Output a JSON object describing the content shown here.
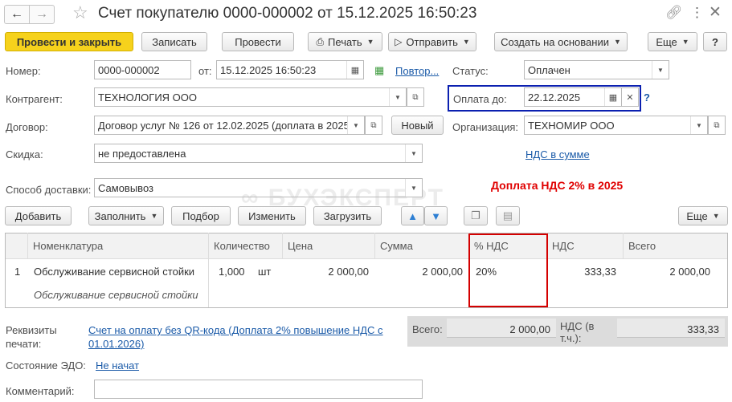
{
  "window": {
    "title": "Счет покупателю 0000-000002 от 15.12.2025 16:50:23"
  },
  "toolbar": {
    "post_close": "Провести и закрыть",
    "save": "Записать",
    "post": "Провести",
    "print": "Печать",
    "send": "Отправить",
    "create_based": "Создать на основании",
    "more": "Еще",
    "help": "?"
  },
  "form": {
    "number_label": "Номер:",
    "number_value": "0000-000002",
    "date_label": "от:",
    "date_value": "15.12.2025 16:50:23",
    "repeat_link": "Повтор...",
    "status_label": "Статус:",
    "status_value": "Оплачен",
    "counterparty_label": "Контрагент:",
    "counterparty_value": "ТЕХНОЛОГИЯ ООО",
    "pay_until_label": "Оплата до:",
    "pay_until_value": "22.12.2025",
    "pay_until_help": "?",
    "contract_label": "Договор:",
    "contract_value": "Договор услуг № 126 от 12.02.2025 (доплата в 2025",
    "new_button": "Новый",
    "org_label": "Организация:",
    "org_value": "ТЕХНОМИР ООО",
    "discount_label": "Скидка:",
    "discount_value": "не предоставлена",
    "vat_in_sum_link": "НДС в сумме",
    "delivery_label": "Способ доставки:",
    "delivery_value": "Самовывоз",
    "annotation": "Доплата НДС 2% в 2025",
    "watermark": "БУХЭКСПЕРТ"
  },
  "table_toolbar": {
    "add": "Добавить",
    "fill": "Заполнить",
    "select": "Подбор",
    "change": "Изменить",
    "load": "Загрузить",
    "more": "Еще"
  },
  "table": {
    "columns": [
      "N",
      "Номенклатура",
      "Количество",
      "Цена",
      "Сумма",
      "% НДС",
      "НДС",
      "Всего"
    ],
    "rows": [
      {
        "n": "1",
        "item": "Обслуживание сервисной стойки",
        "item_desc": "Обслуживание сервисной стойки",
        "qty": "1,000",
        "unit": "шт",
        "price": "2 000,00",
        "sum": "2 000,00",
        "vat_rate": "20%",
        "vat": "333,33",
        "total": "2 000,00"
      }
    ]
  },
  "footer": {
    "print_details_label": "Реквизиты печати:",
    "print_details_link": "Счет на оплату без QR-кода (Доплата 2% повышение НДС с 01.01.2026)",
    "total_label": "Всего:",
    "total_value": "2 000,00",
    "vat_label": "НДС (в т.ч.):",
    "vat_value": "333,33",
    "edo_label": "Состояние ЭДО:",
    "edo_link": "Не начат",
    "comment_label": "Комментарий:",
    "comment_value": ""
  },
  "colors": {
    "primary_button": "#f6d21c",
    "link": "#1a5aa8",
    "highlight_blue": "#0b20b0",
    "highlight_red": "#d40000",
    "annotation_red": "#e00000"
  }
}
